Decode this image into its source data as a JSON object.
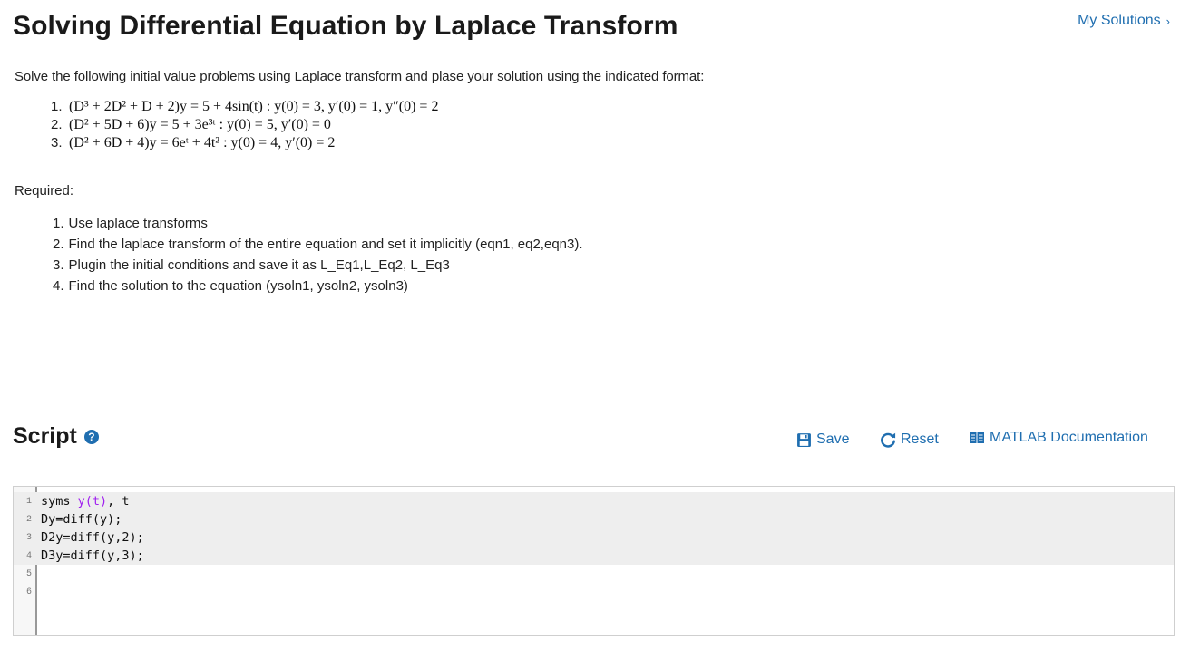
{
  "header": {
    "title": "Solving Differential Equation by Laplace Transform",
    "my_solutions": "My Solutions",
    "my_solutions_chevron": "›"
  },
  "problem": {
    "intro": "Solve the following initial value problems using Laplace transform and plase your solution using the indicated format:",
    "equations": [
      {
        "num": "1.",
        "lhs": "(D³ + 2D² + D + 2)y = 5 + 4sin(t) : y(0) = 3, y′(0) = 1, y″(0) = 2"
      },
      {
        "num": "2.",
        "lhs": "(D² + 5D + 6)y = 5 + 3e³ᵗ : y(0) = 5, y′(0) = 0"
      },
      {
        "num": "3.",
        "lhs": "(D² + 6D + 4)y = 6eᵗ + 4t² : y(0) = 4, y′(0) = 2"
      }
    ],
    "required_label": "Required:",
    "required_items": [
      {
        "num": "1.",
        "text": "Use laplace transforms"
      },
      {
        "num": "2.",
        "text": "Find the laplace transform of the entire equation and set it implicitly (eqn1, eq2,eqn3)."
      },
      {
        "num": "3.",
        "text": "Plugin the initial conditions and save it as L_Eq1,L_Eq2, L_Eq3"
      },
      {
        "num": "4.",
        "text": "Find the solution to the equation (ysoln1, ysoln2, ysoln3)"
      }
    ]
  },
  "script": {
    "title": "Script",
    "help_icon": "question-circle-icon",
    "help_glyph": "?",
    "save_label": "Save",
    "reset_label": "Reset",
    "docs_label": "MATLAB Documentation",
    "lines": [
      {
        "n": "1",
        "pre": "syms ",
        "var": "y(t)",
        "post": ", t"
      },
      {
        "n": "2",
        "pre": "Dy=diff(y);",
        "var": "",
        "post": ""
      },
      {
        "n": "3",
        "pre": "D2y=diff(y,2);",
        "var": "",
        "post": ""
      },
      {
        "n": "4",
        "pre": "D3y=diff(y,3);",
        "var": "",
        "post": ""
      },
      {
        "n": "5",
        "pre": "",
        "var": "",
        "post": ""
      },
      {
        "n": "6",
        "pre": "",
        "var": "",
        "post": ""
      }
    ]
  },
  "colors": {
    "link": "#1f6eb0",
    "variable": "#a020f0"
  }
}
